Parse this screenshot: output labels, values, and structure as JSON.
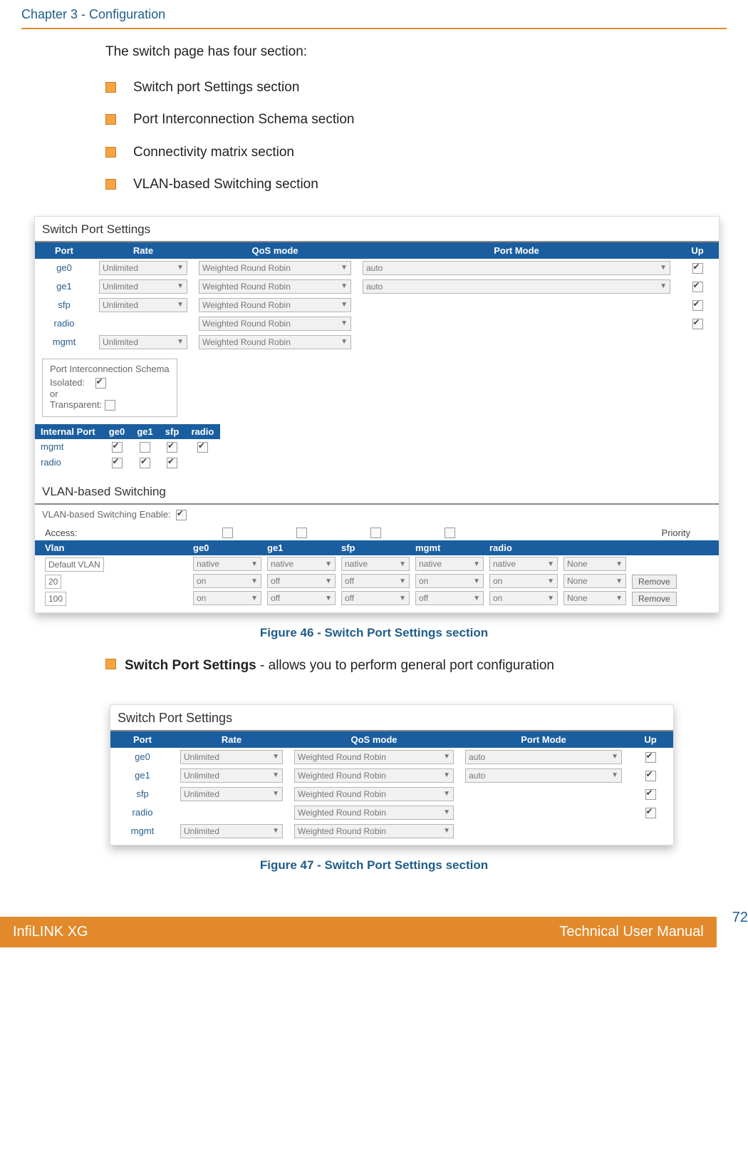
{
  "header": {
    "chapter": "Chapter 3 - Configuration"
  },
  "intro": "The switch page has four section:",
  "bullets": [
    "Switch port Settings section",
    "Port Interconnection Schema section",
    "Connectivity matrix section",
    "VLAN-based Switching section"
  ],
  "fig46": {
    "title": "Switch Port Settings",
    "cols": {
      "port": "Port",
      "rate": "Rate",
      "qos": "QoS mode",
      "mode": "Port Mode",
      "up": "Up"
    },
    "rows": [
      {
        "port": "ge0",
        "rate": "Unlimited",
        "qos": "Weighted Round Robin",
        "mode": "auto",
        "up": true,
        "hasRate": true,
        "hasMode": true
      },
      {
        "port": "ge1",
        "rate": "Unlimited",
        "qos": "Weighted Round Robin",
        "mode": "auto",
        "up": true,
        "hasRate": true,
        "hasMode": true
      },
      {
        "port": "sfp",
        "rate": "Unlimited",
        "qos": "Weighted Round Robin",
        "mode": "",
        "up": true,
        "hasRate": true,
        "hasMode": false
      },
      {
        "port": "radio",
        "rate": "",
        "qos": "Weighted Round Robin",
        "mode": "",
        "up": true,
        "hasRate": false,
        "hasMode": false
      },
      {
        "port": "mgmt",
        "rate": "Unlimited",
        "qos": "Weighted Round Robin",
        "mode": "",
        "up": false,
        "hasRate": true,
        "hasMode": false
      }
    ],
    "schema": {
      "title": "Port Interconnection Schema",
      "isolated_label": "Isolated:",
      "isolated": true,
      "or": "or",
      "transparent_label": "Transparent:",
      "transparent": false
    },
    "matrix": {
      "head": [
        "Internal Port",
        "ge0",
        "ge1",
        "sfp",
        "radio"
      ],
      "rows": [
        {
          "label": "mgmt",
          "vals": [
            true,
            false,
            true,
            true
          ]
        },
        {
          "label": "radio",
          "vals": [
            true,
            true,
            true,
            null
          ]
        }
      ]
    },
    "vlan": {
      "title": "VLAN-based Switching",
      "enable_label": "VLAN-based Switching Enable:",
      "enabled": true,
      "access_label": "Access:",
      "access": [
        false,
        false,
        false,
        false
      ],
      "priority_label": "Priority",
      "head": [
        "Vlan",
        "ge0",
        "ge1",
        "sfp",
        "mgmt",
        "radio"
      ],
      "rows": [
        {
          "vlan": "Default VLAN",
          "vals": [
            "native",
            "native",
            "native",
            "native",
            "native"
          ],
          "prio": "None",
          "removable": false
        },
        {
          "vlan": "20",
          "vals": [
            "on",
            "off",
            "off",
            "on",
            "on"
          ],
          "prio": "None",
          "removable": true
        },
        {
          "vlan": "100",
          "vals": [
            "on",
            "off",
            "off",
            "off",
            "on"
          ],
          "prio": "None",
          "removable": true
        }
      ],
      "remove_label": "Remove"
    },
    "caption": "Figure 46 - Switch Port Settings section"
  },
  "desc": {
    "bold": "Switch Port Settings",
    "rest": " - allows you to perform general port configuration"
  },
  "fig47": {
    "title": "Switch Port Settings",
    "cols": {
      "port": "Port",
      "rate": "Rate",
      "qos": "QoS mode",
      "mode": "Port Mode",
      "up": "Up"
    },
    "rows": [
      {
        "port": "ge0",
        "rate": "Unlimited",
        "qos": "Weighted Round Robin",
        "mode": "auto",
        "up": true,
        "hasRate": true,
        "hasMode": true
      },
      {
        "port": "ge1",
        "rate": "Unlimited",
        "qos": "Weighted Round Robin",
        "mode": "auto",
        "up": true,
        "hasRate": true,
        "hasMode": true
      },
      {
        "port": "sfp",
        "rate": "Unlimited",
        "qos": "Weighted Round Robin",
        "mode": "",
        "up": true,
        "hasRate": true,
        "hasMode": false
      },
      {
        "port": "radio",
        "rate": "",
        "qos": "Weighted Round Robin",
        "mode": "",
        "up": true,
        "hasRate": false,
        "hasMode": false
      },
      {
        "port": "mgmt",
        "rate": "Unlimited",
        "qos": "Weighted Round Robin",
        "mode": "",
        "up": false,
        "hasRate": true,
        "hasMode": false
      }
    ],
    "caption": "Figure 47 - Switch Port Settings section"
  },
  "footer": {
    "left": "InfiLINK XG",
    "right": "Technical User Manual",
    "page": "72"
  }
}
